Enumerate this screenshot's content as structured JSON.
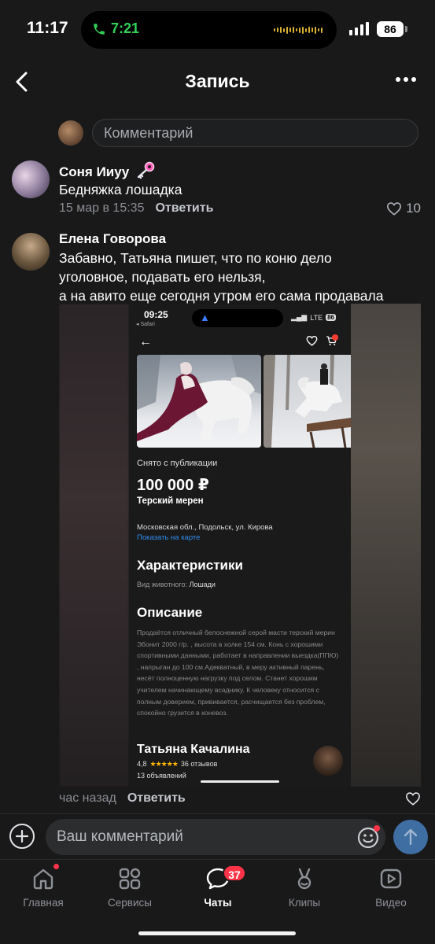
{
  "status": {
    "time": "11:17",
    "call_time": "7:21",
    "battery": "86"
  },
  "header": {
    "title": "Запись"
  },
  "top_comment": {
    "placeholder": "Комментарий"
  },
  "comments": [
    {
      "author": "Соня Ииуу",
      "text": "Бедняжка лошадка",
      "time": "15 мар в 15:35",
      "reply": "Ответить",
      "likes": "10"
    },
    {
      "author": "Елена Говорова",
      "text_lines": [
        "Забавно, Татьяна пишет, что по коню дело",
        "уголовное, подавать его нельзя,",
        "а на авито еще сегодня утром его сама продавала"
      ],
      "time": "час назад",
      "reply": "Ответить"
    }
  ],
  "attachment": {
    "status_time": "09:25",
    "status_app": "◂ Safari",
    "status_net": "LTE",
    "status_batt": "86",
    "unpublished": "Снято с публикации",
    "price": "100 000 ₽",
    "name": "Терский мерен",
    "address": "Московская обл., Подольск, ул. Кирова",
    "show_map": "Показать на карте",
    "chars_heading": "Характеристики",
    "char_label": "Вид животного:",
    "char_value": "Лошади",
    "desc_heading": "Описание",
    "description": "Продаётся отличный белоснежной серой масти терский мерин Эбонит 2000 г/р. , высота в холке 154 см. Конь с хорошими спортивными данными, работает в направлении выездка(ППЮ) , напрыган до 100 см.Адекватный, в меру активный парень, несёт полноценную нагрузку под селом. Станет хорошим учителем начинающему всаднику. К человеку относится с полным доверием, прививается, расчищается без проблем, спокойно грузится в коневоз.",
    "seller": "Татьяна Качалина",
    "rating": "4,8",
    "stars": "★★★★★",
    "reviews": "36 отзывов",
    "ads": "13 объявлений"
  },
  "compose": {
    "placeholder": "Ваш комментарий"
  },
  "tabs": [
    {
      "label": "Главная"
    },
    {
      "label": "Сервисы"
    },
    {
      "label": "Чаты",
      "badge": "37"
    },
    {
      "label": "Клипы"
    },
    {
      "label": "Видео"
    }
  ],
  "colors": {
    "background": "#19191a",
    "accent_blue": "#3f6ea2",
    "badge_red": "#ff3347",
    "call_green": "#33d15a"
  }
}
